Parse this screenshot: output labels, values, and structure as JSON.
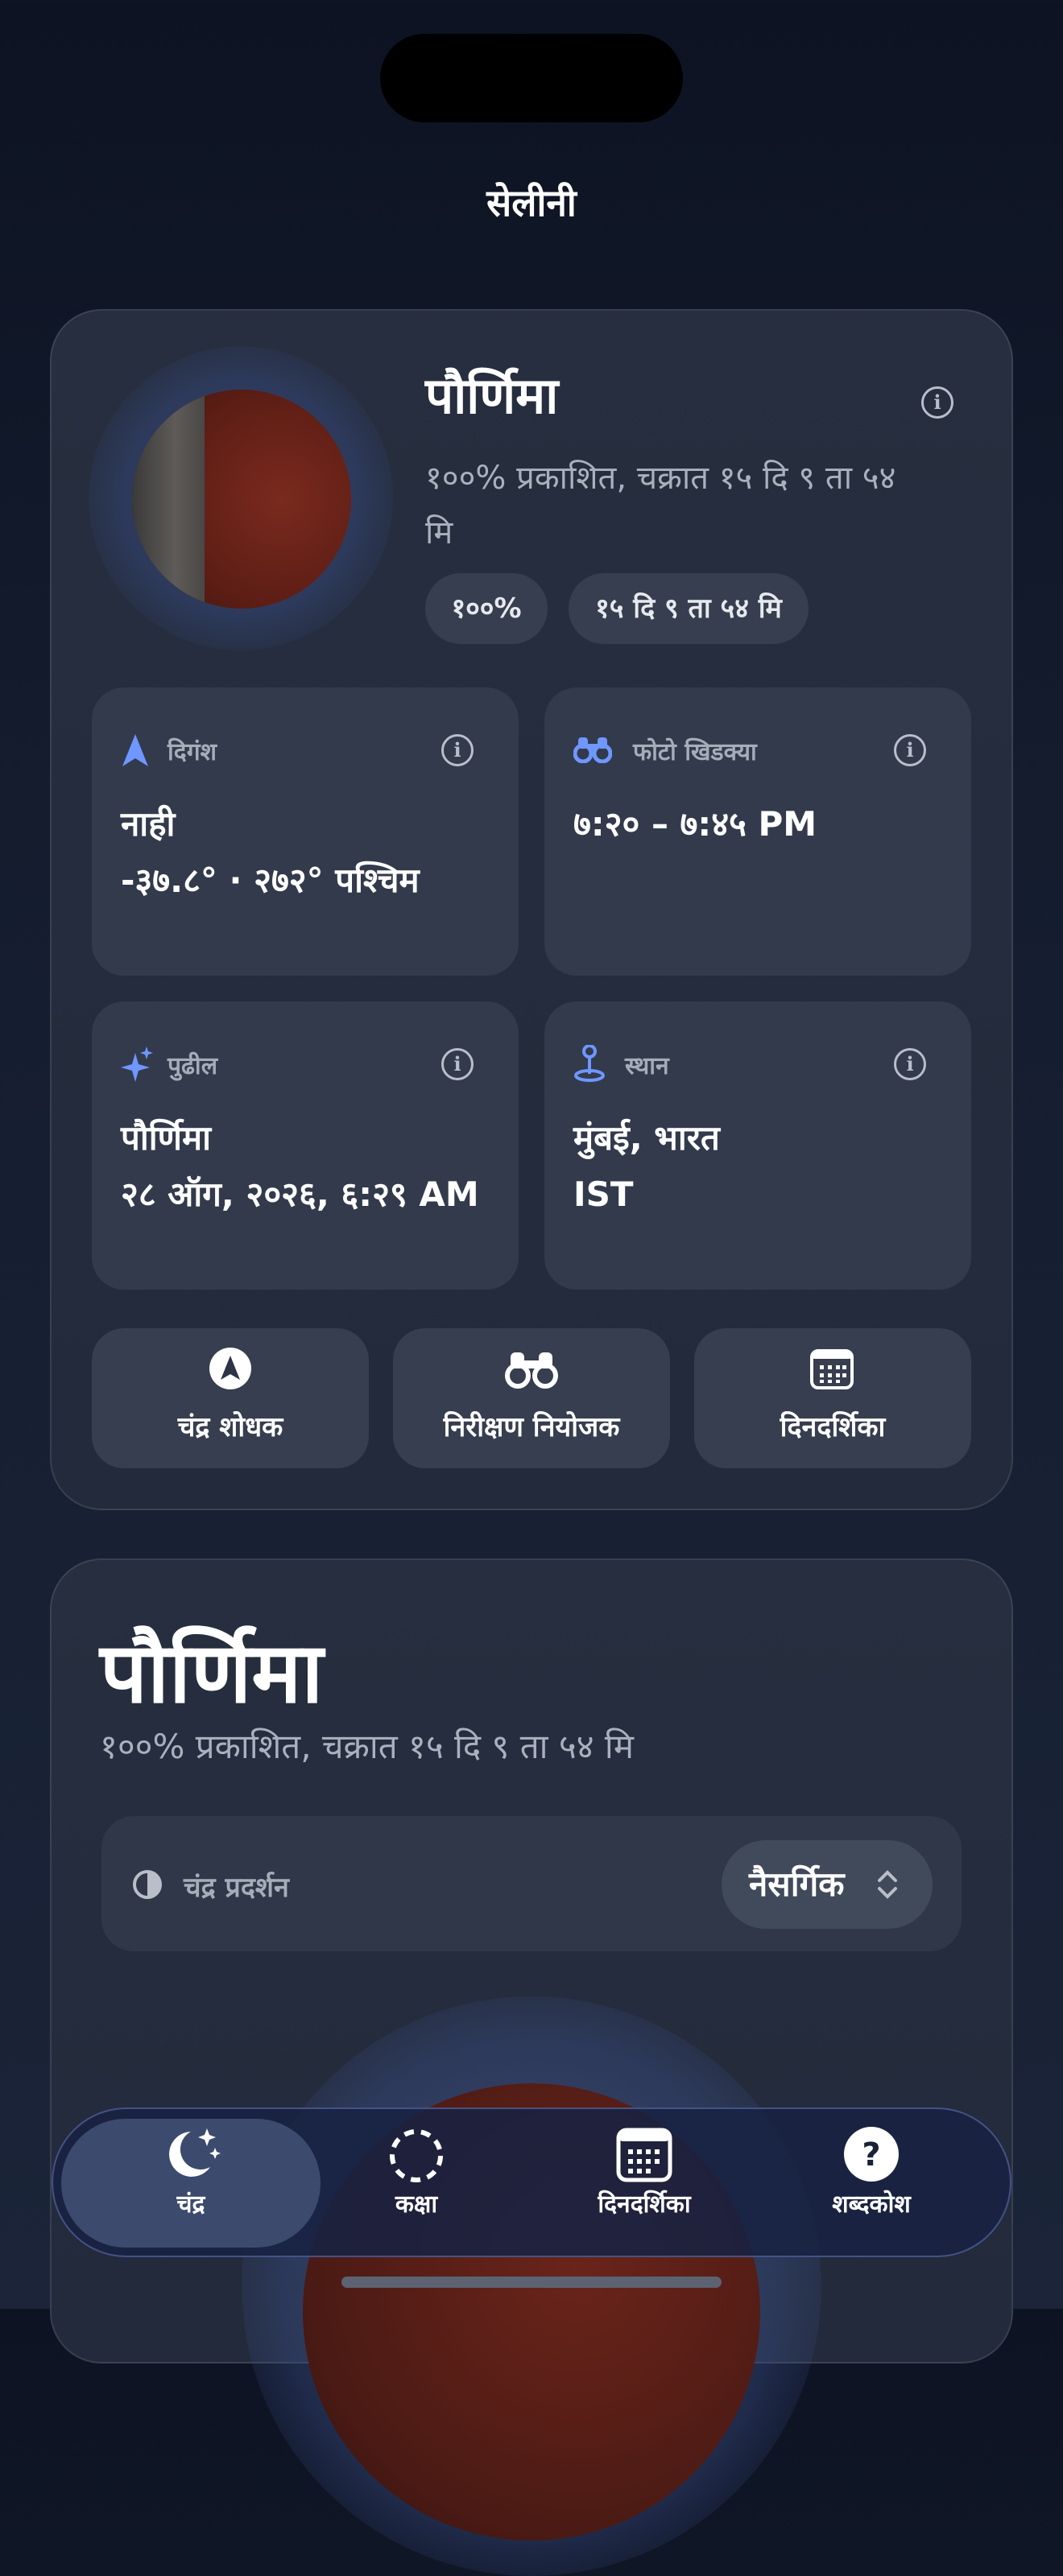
{
  "app": {
    "title": "सेलीनी"
  },
  "phase_card": {
    "phase_name": "पौर्णिमा",
    "subtitle": "१००% प्रकाशित, चक्रात १५ दि ९ ता ५४ मि",
    "chips": [
      "१००%",
      "१५ दि ९ ता ५४ मि"
    ],
    "info_icon": "info-icon"
  },
  "tiles": {
    "azimuth": {
      "label": "दिगंश",
      "icon": "location-arrow-icon",
      "line1": "नाही",
      "line2": "-३७.८° · २७२° पश्चिम"
    },
    "photo_window": {
      "label": "फोटो खिडक्या",
      "icon": "binoculars-icon",
      "line1": "७:२० – ७:४५ PM"
    },
    "next": {
      "label": "पुढील",
      "icon": "sparkles-icon",
      "line1": "पौर्णिमा",
      "line2": "२८ ऑग, २०२६, ६:२९ AM"
    },
    "location": {
      "label": "स्थान",
      "icon": "location-pin-icon",
      "line1": "मुंबई, भारत",
      "line2": "IST"
    }
  },
  "quick_actions": [
    {
      "label": "चंद्र शोधक",
      "icon": "compass-arrow-icon"
    },
    {
      "label": "निरीक्षण नियोजक",
      "icon": "binoculars-icon"
    },
    {
      "label": "दिनदर्शिका",
      "icon": "calendar-icon"
    }
  ],
  "detail": {
    "title": "पौर्णिमा",
    "subtitle": "१००% प्रकाशित, चक्रात १५ दि ९ ता ५४ मि",
    "display_label": "चंद्र प्रदर्शन",
    "display_value": "नैसर्गिक"
  },
  "tabbar": {
    "tabs": [
      {
        "label": "चंद्र",
        "icon": "moon-stars-icon",
        "active": true
      },
      {
        "label": "कक्षा",
        "icon": "orbit-icon",
        "active": false
      },
      {
        "label": "दिनदर्शिका",
        "icon": "calendar-icon",
        "active": false
      },
      {
        "label": "शब्दकोश",
        "icon": "question-icon",
        "active": false
      }
    ]
  },
  "colors": {
    "accent": "#6f97ff",
    "background": "#141c2e",
    "card": "#262e3f",
    "tile": "#323a4c"
  }
}
